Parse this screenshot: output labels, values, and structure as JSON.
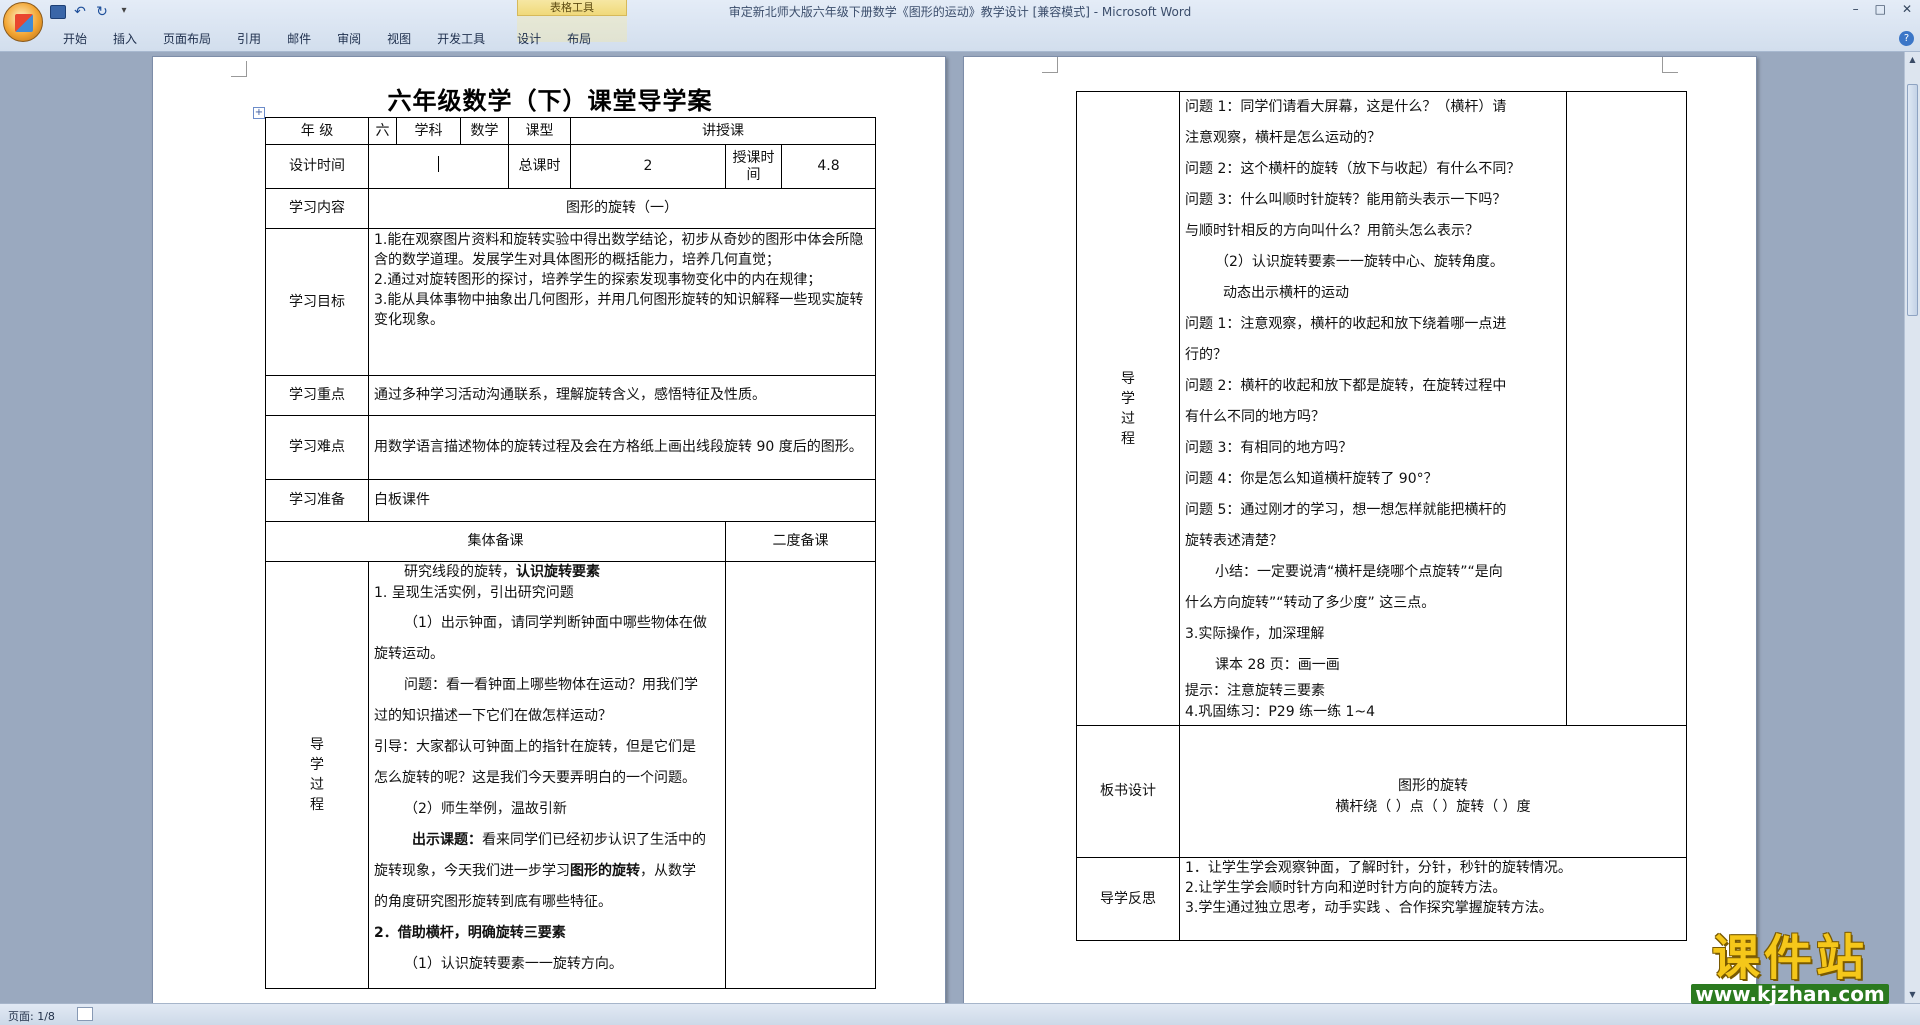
{
  "window": {
    "title": "审定新北师大版六年级下册数学《图形的运动》教学设计 [兼容模式] - Microsoft Word",
    "context_tab": "表格工具"
  },
  "ribbon": {
    "tabs": [
      "开始",
      "插入",
      "页面布局",
      "引用",
      "邮件",
      "审阅",
      "视图",
      "开发工具",
      "设计",
      "布局"
    ]
  },
  "page1": {
    "title": "六年级数学（下）课堂导学案",
    "row1": {
      "grade_label": "年 级",
      "grade_value": "六",
      "subject_label": "学科",
      "subject_value": "数学",
      "type_label": "课型",
      "type_value": "讲授课"
    },
    "row2": {
      "design_time_label": "设计时间",
      "design_time_value": "",
      "total_label": "总课时",
      "total_value": "2",
      "lesson_time_label": "授课时间",
      "lesson_time_value": "4.8"
    },
    "content_label": "学习内容",
    "content_value": "图形的旋转（一）",
    "goals_label": "学习目标",
    "goals": [
      "1.能在观察图片资料和旋转实验中得出数学结论，初步从奇妙的图形中体会所隐含的数学道理。发展学生对具体图形的概括能力，培养几何直觉；",
      "2.通过对旋转图形的探讨，培养学生的探索发现事物变化中的内在规律；",
      "3.能从具体事物中抽象出几何图形，并用几何图形旋转的知识解释一些现实旋转变化现象。"
    ],
    "key_label": "学习重点",
    "key_value": "通过多种学习活动沟通联系，理解旋转含义，感悟特征及性质。",
    "difficulty_label": "学习难点",
    "difficulty_value": "用数学语言描述物体的旋转过程及会在方格纸上画出线段旋转 90 度后的图形。",
    "prep_label": "学习准备",
    "prep_value": "白板课件",
    "collective_label": "集体备课",
    "second_label": "二度备课",
    "process_label": [
      "导",
      "学",
      "过",
      "程"
    ],
    "process": {
      "l1": "研究线段的旋转，",
      "l1b": "认识旋转要素",
      "l2": "1.   呈现生活实例，引出研究问题",
      "l3": "（1）出示钟面，请同学判断钟面中哪些物体在做",
      "l4": "旋转运动。",
      "l5": "问题：看一看钟面上哪些物体在运动？用我们学",
      "l6": "过的知识描述一下它们在做怎样运动？",
      "l7": "引导：大家都认可钟面上的指针在旋转，但是它们是",
      "l8": "怎么旋转的呢？这是我们今天要弄明白的一个问题。",
      "l9": "（2）师生举例，温故引新",
      "l10a": "出示课题：",
      "l10b": "看来同学们已经初步认识了生活中的",
      "l11a": "旋转现象，今天我们进一步学习",
      "l11b": "图形的旋转",
      "l11c": "，从数学",
      "l12": "的角度研究图形旋转到底有哪些特征。",
      "l13a": "2．借助",
      "l13b": "横杆",
      "l13c": "，明确旋转三要素",
      "l14": "（1）认识旋转要素一一旋转方向。"
    }
  },
  "page2": {
    "process_label": [
      "导",
      "学",
      "过",
      "程"
    ],
    "lines": [
      "问题 1：同学们请看大屏幕，这是什么？（横杆）请",
      "注意观察，横杆是怎么运动的？",
      "问题 2：这个横杆的旋转（放下与收起）有什么不同？",
      "问题 3：什么叫顺时针旋转？能用箭头表示一下吗？",
      "与顺时针相反的方向叫什么？用箭头怎么表示？",
      "（2）认识旋转要素一一旋转中心、旋转角度。",
      "动态出示横杆的运动",
      "问题 1：注意观察，横杆的收起和放下绕着哪一点进",
      "行的？",
      "问题 2：横杆的收起和放下都是旋转，在旋转过程中",
      "有什么不同的地方吗？",
      "问题 3：有相同的地方吗？",
      "问题 4：你是怎么知道横杆旋转了 90°？",
      "问题 5：通过刚才的学习，想一想怎样就能把横杆的",
      "旋转表述清楚？",
      "小结：一定要说清“横杆是绕哪个点旋转”“是向",
      "什么方向旋转”“转动了多少度” 这三点。",
      "3.实际操作，加深理解",
      "课本 28 页：画一画",
      "提示：注意旋转三要素",
      "4.巩固练习：P29 练一练 1~4"
    ],
    "board_label": "板书设计",
    "board_title": "图形的旋转",
    "board_line": "横杆绕（    ）点（        ）旋转（       ）度",
    "reflect_label": "导学反思",
    "reflect": [
      "1．让学生学会观察钟面，了解时针，分针，秒针的旋转情况。",
      "2.让学生学会顺时针方向和逆时针方向的旋转方法。",
      "3.学生通过独立思考，动手实践 、合作探究掌握旋转方法。"
    ]
  },
  "status": {
    "page": "页面: 1/8"
  },
  "watermark": {
    "main": "课件站",
    "url": "www.kjzhan.com"
  }
}
